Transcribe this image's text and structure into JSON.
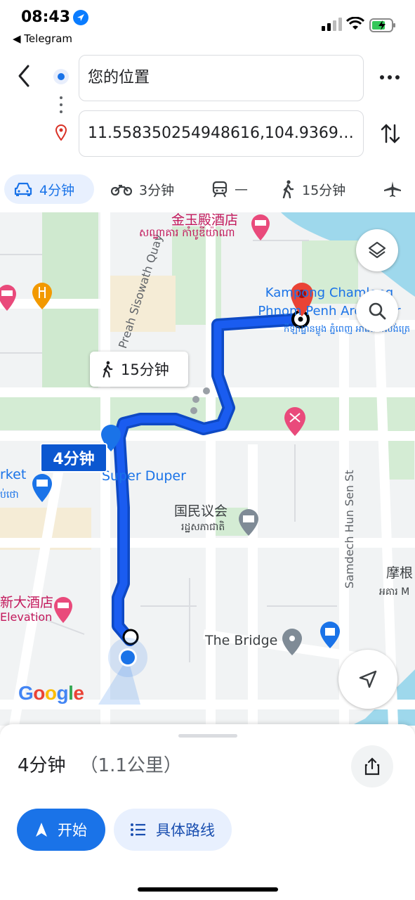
{
  "status_bar": {
    "time": "08:43",
    "back_app": "◀ Telegram"
  },
  "directions": {
    "origin": "您的位置",
    "destination": "11.558350254948616,104.93693..."
  },
  "modes": [
    {
      "name": "car",
      "label": "4分钟",
      "selected": true
    },
    {
      "name": "motorcycle",
      "label": "3分钟"
    },
    {
      "name": "transit",
      "label": "—"
    },
    {
      "name": "walk",
      "label": "15分钟"
    },
    {
      "name": "flight",
      "label": ""
    }
  ],
  "map": {
    "labels": {
      "hotel_top_cn": "金玉殿酒店",
      "hotel_top_km": "សណ្ឋាគារ កាំបូឌីយ៉ាណា",
      "quay": "Preah Sisowath Quay",
      "arena": "Kampong Chamlong Phnom Penh Arena Ctr",
      "arena_km": "កីឡាដ្ឋានម្លូង ភ្នំពេញ អារ៉េណាសង់ត្រេ",
      "market": "rket",
      "market_km": "ប់ថោ",
      "super_duper": "Super Duper",
      "national_assembly_cn": "国民议会",
      "national_assembly_km": "រដ្ឋសភាជាតិ",
      "hun_sen": "Samdech Hun Sen St",
      "hotel_left_cn": "新大酒店",
      "elevation": "Elevation",
      "the_bridge": "The Bridge",
      "right_cn": "摩根",
      "right_km": "អគារ M"
    },
    "walk_time": "15分钟",
    "drive_time": "4分钟",
    "logo": "Google"
  },
  "route_summary": {
    "duration": "4分钟",
    "distance": "（1.1公里）"
  },
  "actions": {
    "start": "开始",
    "steps": "具体路线"
  },
  "colors": {
    "accent": "#1a73e8",
    "route": "#1a5cf0",
    "destination_pin": "#ea4335"
  }
}
